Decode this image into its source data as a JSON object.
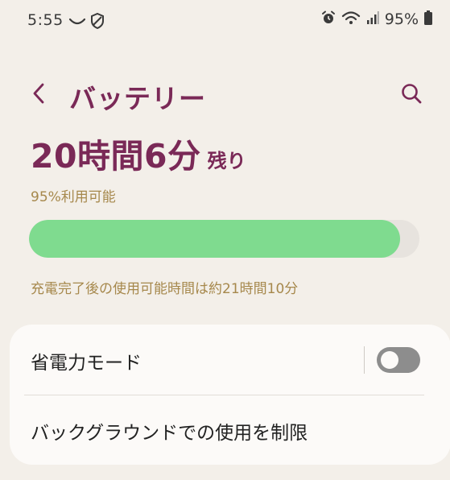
{
  "status_bar": {
    "time": "5:55",
    "battery_percent": "95%",
    "icons_left": [
      "wave-icon",
      "shield-icon"
    ],
    "icons_right": [
      "alarm-icon",
      "wifi-icon",
      "signal-icon",
      "battery-icon"
    ]
  },
  "header": {
    "title": "バッテリー",
    "back_icon": "chevron-left-icon",
    "search_icon": "search-icon"
  },
  "battery": {
    "remaining_time": "20時間6分",
    "remaining_suffix": "残り",
    "available_text": "95%利用可能",
    "level_percent": 95,
    "full_charge_text": "充電完了後の使用可能時間は約21時間10分"
  },
  "settings": {
    "power_saving_label": "省電力モード",
    "power_saving_enabled": false,
    "background_limit_label": "バックグラウンドでの使用を制限"
  },
  "colors": {
    "accent": "#7a2957",
    "subtext": "#a6884c",
    "battery_fill": "#7fdb8f",
    "background": "#f3efe9",
    "card": "#fcfaf8",
    "toggle_off": "#8d8d8d"
  }
}
